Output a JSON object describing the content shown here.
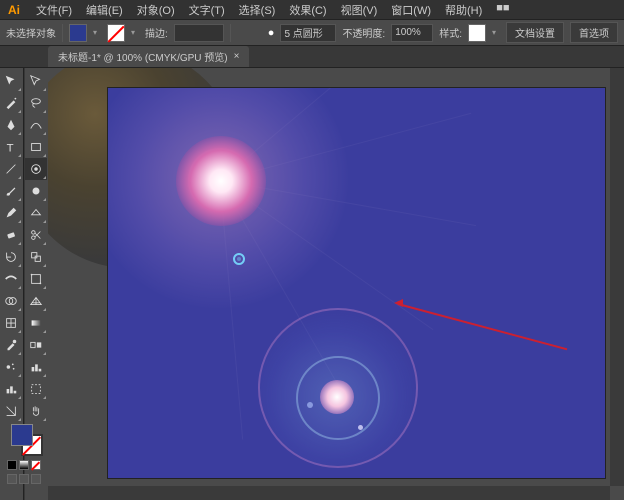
{
  "app": {
    "icon_text": "Ai"
  },
  "menu": {
    "items": [
      "文件(F)",
      "编辑(E)",
      "对象(O)",
      "文字(T)",
      "选择(S)",
      "效果(C)",
      "视图(V)",
      "窗口(W)",
      "帮助(H)",
      "■■"
    ]
  },
  "controlbar": {
    "selection_label": "未选择对象",
    "stroke_label": "描边:",
    "stroke_value": "",
    "point_value": "5 点圆形",
    "opacity_label": "不透明度:",
    "opacity_value": "100%",
    "style_label": "样式:",
    "doc_setup": "文档设置",
    "preferences": "首选项"
  },
  "doctab": {
    "title": "未标题-1* @ 100% (CMYK/GPU 预览)",
    "close": "×"
  },
  "tools_left": [
    {
      "name": "selection-tool",
      "glyph": "sel"
    },
    {
      "name": "magic-wand-tool",
      "glyph": "wand"
    },
    {
      "name": "pen-tool",
      "glyph": "pen"
    },
    {
      "name": "type-tool",
      "glyph": "type"
    },
    {
      "name": "line-tool",
      "glyph": "line"
    },
    {
      "name": "paintbrush-tool",
      "glyph": "brush"
    },
    {
      "name": "pencil-tool",
      "glyph": "pencil"
    },
    {
      "name": "eraser-tool",
      "glyph": "eraser"
    },
    {
      "name": "rotate-tool",
      "glyph": "rotate"
    },
    {
      "name": "width-tool",
      "glyph": "width"
    },
    {
      "name": "shape-builder-tool",
      "glyph": "shapeb"
    },
    {
      "name": "mesh-tool",
      "glyph": "mesh"
    },
    {
      "name": "eyedropper-tool",
      "glyph": "eyedrop"
    },
    {
      "name": "symbol-spray-tool",
      "glyph": "spray"
    },
    {
      "name": "graph-tool",
      "glyph": "graph"
    },
    {
      "name": "slice-tool",
      "glyph": "slice"
    }
  ],
  "tools_right": [
    {
      "name": "direct-selection-tool",
      "glyph": "dsel"
    },
    {
      "name": "lasso-tool",
      "glyph": "lasso"
    },
    {
      "name": "curvature-tool",
      "glyph": "curve"
    },
    {
      "name": "rectangle-tool",
      "glyph": "rect"
    },
    {
      "name": "flare-tool",
      "glyph": "flare",
      "active": true
    },
    {
      "name": "blob-brush-tool",
      "glyph": "blob"
    },
    {
      "name": "shaper-tool",
      "glyph": "shaper"
    },
    {
      "name": "scissors-tool",
      "glyph": "scissor"
    },
    {
      "name": "scale-tool",
      "glyph": "scale"
    },
    {
      "name": "free-transform-tool",
      "glyph": "freet"
    },
    {
      "name": "perspective-tool",
      "glyph": "persp"
    },
    {
      "name": "gradient-tool",
      "glyph": "grad"
    },
    {
      "name": "blend-tool",
      "glyph": "blend"
    },
    {
      "name": "column-graph-tool",
      "glyph": "colgraph"
    },
    {
      "name": "artboard-tool",
      "glyph": "artb"
    },
    {
      "name": "hand-tool",
      "glyph": "hand"
    }
  ],
  "colors": {
    "fill": "#2b3a8f",
    "stroke": "none",
    "mini": [
      "#000000",
      "#333333",
      "#ffffff"
    ]
  }
}
